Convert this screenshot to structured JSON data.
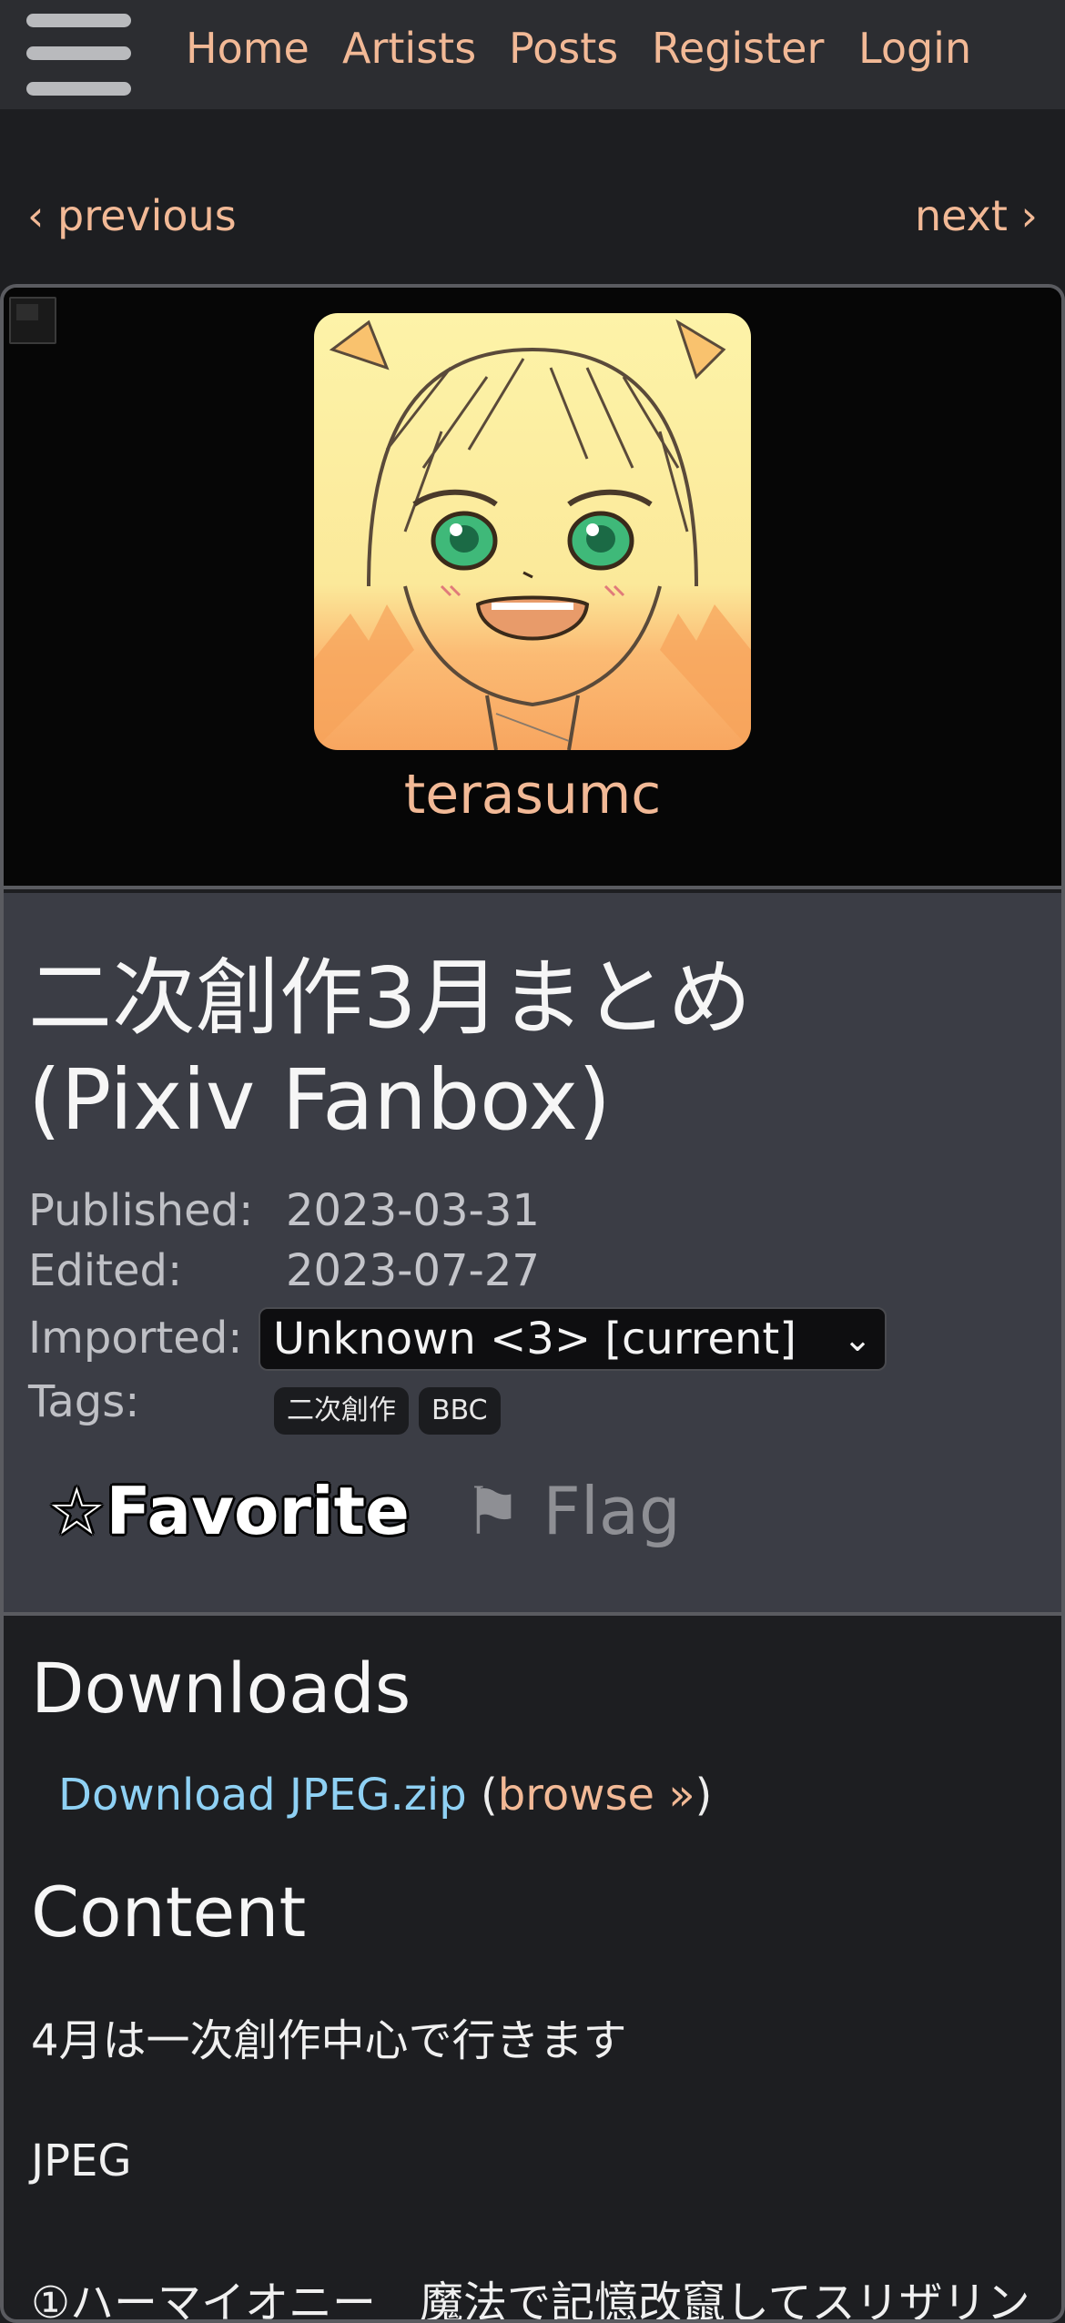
{
  "nav": {
    "menu_icon": "hamburger-menu-icon",
    "items": [
      "Home",
      "Artists",
      "Posts",
      "Register",
      "Login"
    ]
  },
  "pager": {
    "previous": "‹ previous",
    "next": "next ›"
  },
  "artist": {
    "name": "terasumc",
    "avatar_icon": "artist-avatar"
  },
  "post": {
    "title_line1": "二次創作3月まとめ",
    "title_line2": "(Pixiv Fanbox)",
    "published_label": "Published:",
    "published_value": "2023-03-31",
    "edited_label": "Edited:",
    "edited_value": "2023-07-27",
    "imported_label": "Imported:",
    "imported_selected": "Unknown <3> [current]",
    "tags_label": "Tags:",
    "tags": [
      "二次創作",
      "BBC"
    ],
    "favorite_label": "☆Favorite",
    "flag_label": "⚑ Flag"
  },
  "downloads": {
    "heading": "Downloads",
    "file_link": "Download JPEG.zip",
    "open_paren": "(",
    "browse": "browse »",
    "close_paren": ")"
  },
  "content": {
    "heading": "Content",
    "lines": [
      "4月は一次創作中心で行きます",
      "JPEG",
      "①ハーマイオニー　魔法で記憶改竄してスリザリン"
    ]
  },
  "colors": {
    "link": "#f2b996",
    "download_link": "#8fd1f4",
    "background": "#1d1e21",
    "header": "#2c2d31",
    "info_panel": "#3b3d45"
  }
}
